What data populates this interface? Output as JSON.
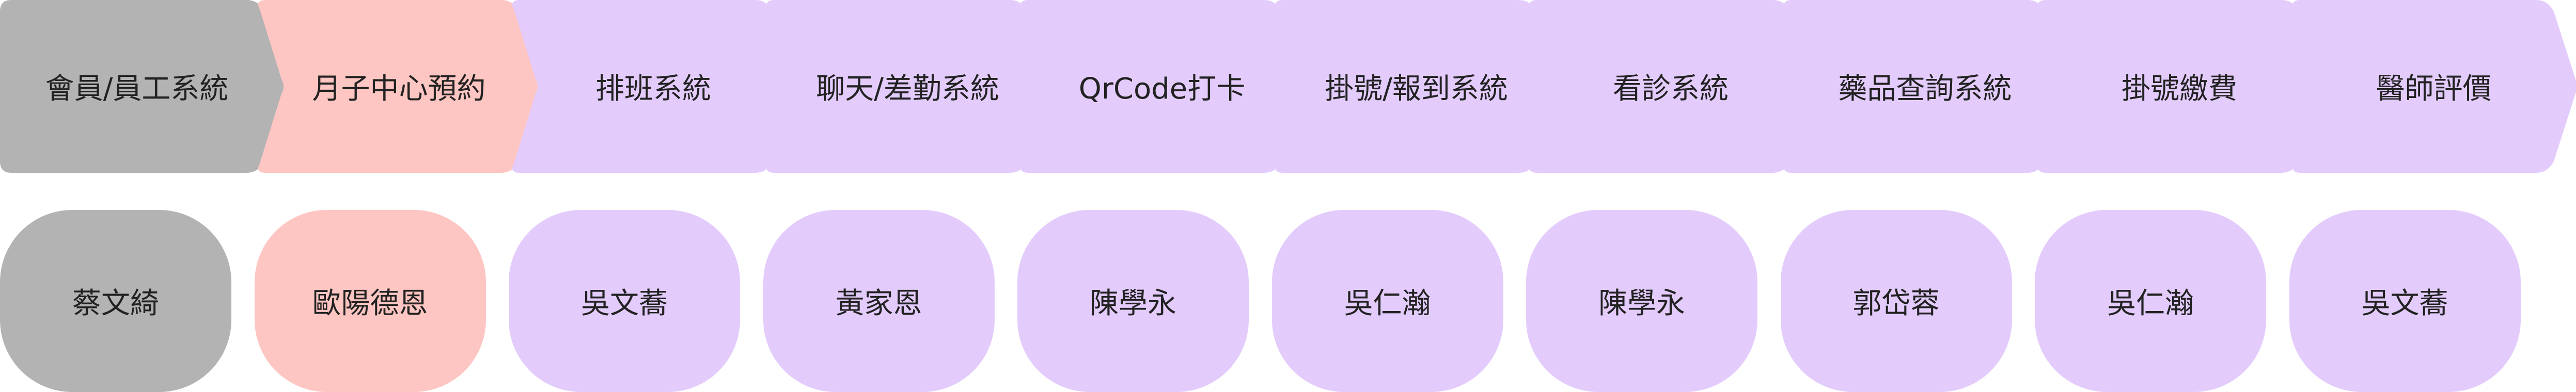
{
  "colors": {
    "gray": "#b3b3b3",
    "pink": "#fec6c2",
    "lavender": "#e3ccfc"
  },
  "steps": [
    {
      "label": "會員/員工系統",
      "color": "gray"
    },
    {
      "label": "月子中心預約",
      "color": "pink"
    },
    {
      "label": "排班系統",
      "color": "lavender"
    },
    {
      "label": "聊天/差勤系統",
      "color": "lavender"
    },
    {
      "label": "QrCode打卡",
      "color": "lavender"
    },
    {
      "label": "掛號/報到系統",
      "color": "lavender"
    },
    {
      "label": "看診系統",
      "color": "lavender"
    },
    {
      "label": "藥品查詢系統",
      "color": "lavender"
    },
    {
      "label": "掛號繳費",
      "color": "lavender"
    },
    {
      "label": "醫師評價",
      "color": "lavender"
    }
  ],
  "owners": [
    {
      "name": "蔡文綺",
      "color": "gray"
    },
    {
      "name": "歐陽德恩",
      "color": "pink"
    },
    {
      "name": "吳文蕎",
      "color": "lavender"
    },
    {
      "name": "黃家恩",
      "color": "lavender"
    },
    {
      "name": "陳學永",
      "color": "lavender"
    },
    {
      "name": "吳仁瀚",
      "color": "lavender"
    },
    {
      "name": "陳學永",
      "color": "lavender"
    },
    {
      "name": "郭岱蓉",
      "color": "lavender"
    },
    {
      "name": "吳仁瀚",
      "color": "lavender"
    },
    {
      "name": "吳文蕎",
      "color": "lavender"
    }
  ]
}
